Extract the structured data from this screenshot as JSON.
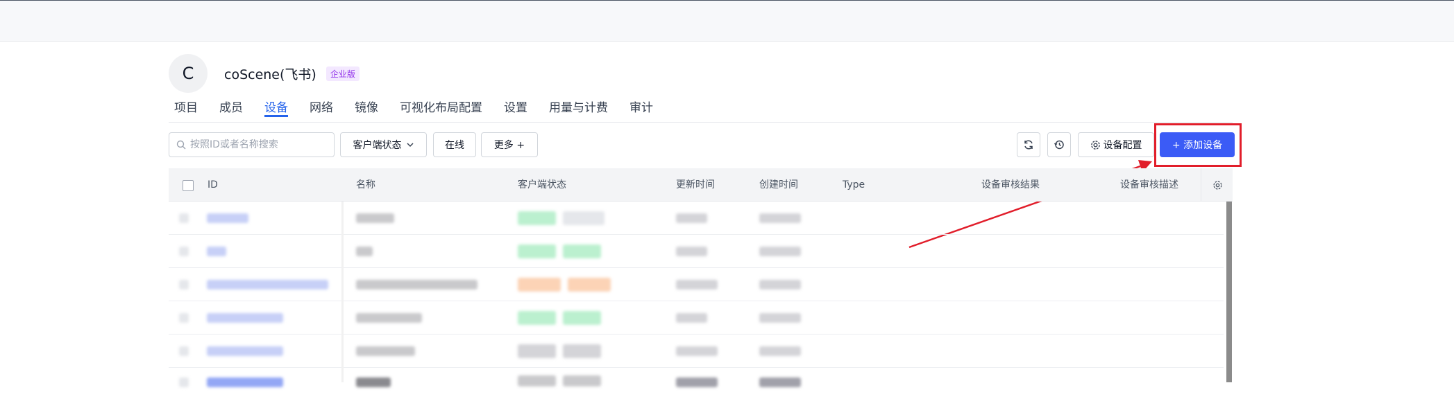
{
  "org": {
    "avatar_letter": "C",
    "name": "coScene(飞书)",
    "badge": "企业版"
  },
  "tabs": [
    {
      "label": "项目"
    },
    {
      "label": "成员"
    },
    {
      "label": "设备",
      "active": true
    },
    {
      "label": "网络"
    },
    {
      "label": "镜像"
    },
    {
      "label": "可视化布局配置"
    },
    {
      "label": "设置"
    },
    {
      "label": "用量与计费"
    },
    {
      "label": "审计"
    }
  ],
  "toolbar": {
    "search_placeholder": "按照ID或者名称搜索",
    "client_status_label": "客户端状态",
    "online_label": "在线",
    "more_label": "更多 +",
    "device_config_label": "设备配置",
    "add_device_label": "+ 添加设备"
  },
  "table": {
    "columns": [
      "ID",
      "名称",
      "客户端状态",
      "更新时间",
      "创建时间",
      "Type",
      "设备审核结果",
      "设备审核描述"
    ]
  },
  "colors": {
    "accent": "#3b5bf6",
    "highlight": "#e11d2a",
    "online": "#86efac",
    "offline": "#fdba74"
  }
}
